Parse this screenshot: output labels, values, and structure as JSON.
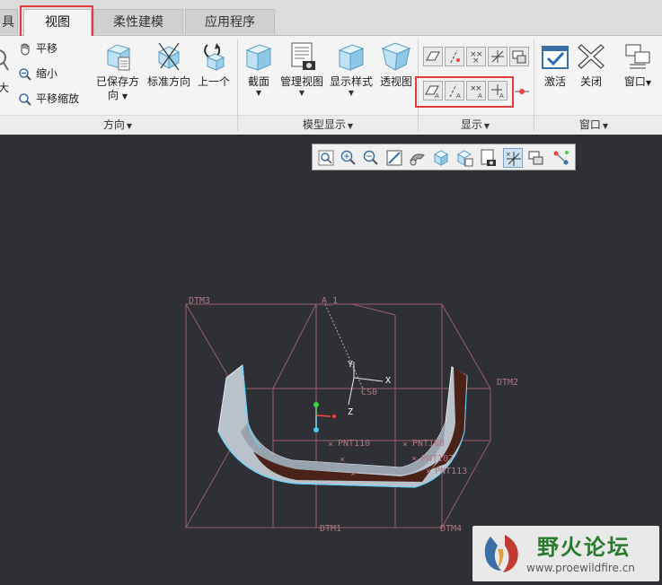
{
  "tabs": [
    {
      "label": "具",
      "active": false
    },
    {
      "label": "视图",
      "active": true
    },
    {
      "label": "柔性建模",
      "active": false
    },
    {
      "label": "应用程序",
      "active": false
    }
  ],
  "ribbon": {
    "orientation": {
      "label": "方向",
      "left_partial": "大",
      "pan": "平移",
      "zoom_out": "缩小",
      "pan_zoom": "平移缩放",
      "saved_orientation_line1": "已保存方",
      "saved_orientation_line2": "向",
      "standard_orientation": "标准方向",
      "previous": "上一个"
    },
    "model_display": {
      "label": "模型显示",
      "section": "截面",
      "manage_views": "管理视图",
      "display_style": "显示样式",
      "perspective": "透视图"
    },
    "display": {
      "label": "显示"
    },
    "window": {
      "label": "窗口",
      "activate": "激活",
      "close": "关闭",
      "window": "窗口"
    }
  },
  "viewport": {
    "datums": {
      "dtm1": "DTM1",
      "dtm2": "DTM2",
      "dtm3": "DTM3",
      "dtm4": "DTM4",
      "axis": "A_1",
      "csys": "CS0"
    },
    "points": [
      "PNT110",
      "PNT108",
      "PNT107",
      "PNT113"
    ],
    "axes": {
      "x": "X",
      "y": "Y",
      "z": "Z"
    }
  },
  "watermark": {
    "title": "野火论坛",
    "url": "www.proewildfire.cn"
  },
  "colors": {
    "highlight": "#e03c3c",
    "datum_plane": "#b07883",
    "model_surface": "#b8c0c8",
    "model_inner": "#4a2218",
    "background": "#2f3035"
  }
}
